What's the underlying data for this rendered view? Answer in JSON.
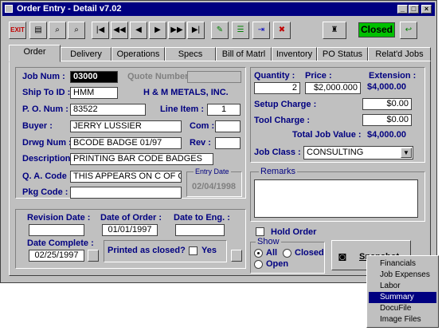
{
  "window": {
    "title": "Order Entry - Detail v7.02",
    "status": "Closed"
  },
  "tabs": [
    "Order",
    "Delivery",
    "Operations",
    "Specs",
    "Bill of Matrl",
    "Inventory",
    "PO Status",
    "Relat'd Jobs"
  ],
  "left": {
    "job_num_label": "Job Num :",
    "job_num": "03000",
    "quote_number_label": "Quote Number :",
    "ship_to_label": "Ship To ID :",
    "ship_to": "HMM",
    "company": "H & M METALS, INC.",
    "po_num_label": "P. O. Num :",
    "po_num": "83522",
    "line_item_label": "Line Item :",
    "line_item": "1",
    "buyer_label": "Buyer :",
    "buyer": "JERRY LUSSIER",
    "com_label": "Com :",
    "drwg_label": "Drwg Num :",
    "drwg": "BCODE BADGE 01/97",
    "rev_label": "Rev :",
    "description_label": "Description :",
    "description": "PRINTING BAR CODE BADGES",
    "qa_label": "Q. A. Code :",
    "qa": "THIS APPEARS ON C OF C",
    "pkg_label": "Pkg Code :",
    "entry_date_label": "Entry Date",
    "entry_date": "02/04/1998"
  },
  "right": {
    "quantity_label": "Quantity :",
    "quantity": "2",
    "price_label": "Price :",
    "price": "$2,000.000",
    "extension_label": "Extension :",
    "extension": "$4,000.00",
    "setup_label": "Setup Charge :",
    "setup": "$0.00",
    "tool_label": "Tool Charge :",
    "tool": "$0.00",
    "total_label": "Total Job Value :",
    "total": "$4,000.00",
    "job_class_label": "Job Class :",
    "job_class": "CONSULTING",
    "remarks_label": "Remarks"
  },
  "dates": {
    "revision_label": "Revision Date :",
    "order_label": "Date of Order :",
    "order": "01/01/1997",
    "eng_label": "Date to Eng. :",
    "complete_label": "Date Complete :",
    "complete": "02/25/1997",
    "printed_label": "Printed as closed?",
    "printed_yes": "Yes"
  },
  "hold_order": "Hold Order",
  "show": {
    "label": "Show",
    "all": "All",
    "closed": "Closed",
    "open": "Open"
  },
  "snapshot": "Snapshot",
  "context_menu": [
    "Financials",
    "Job Expenses",
    "Labor",
    "Summary",
    "DocuFile",
    "Image Files"
  ],
  "colors": {
    "title_bar": "#000080",
    "status_closed": "#00c000",
    "label": "#000080"
  }
}
